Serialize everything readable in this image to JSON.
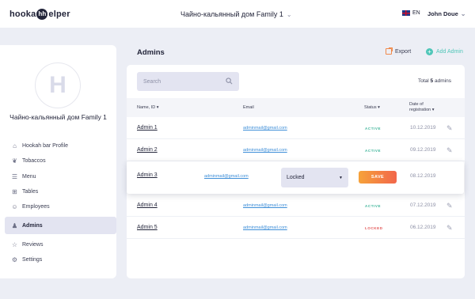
{
  "header": {
    "logo_left": "hooka",
    "logo_mark": "hh",
    "logo_right": "elper",
    "venue": "Чайно-кальянный дом Family 1",
    "language": "EN",
    "user": "John Doue"
  },
  "sidebar": {
    "avatar_letter": "H",
    "venue_name": "Чайно-кальянный дом Family 1",
    "items": [
      {
        "label": "Hookah bar Profile",
        "icon": "home-icon"
      },
      {
        "label": "Tobaccos",
        "icon": "leaf-icon"
      },
      {
        "label": "Menu",
        "icon": "menu-icon"
      },
      {
        "label": "Tables",
        "icon": "table-icon"
      },
      {
        "label": "Employees",
        "icon": "employees-icon"
      },
      {
        "label": "Admins",
        "icon": "admin-icon",
        "active": true
      },
      {
        "label": "Reviews",
        "icon": "star-icon"
      },
      {
        "label": "Settings",
        "icon": "gear-icon"
      }
    ]
  },
  "main": {
    "title": "Admins",
    "export_label": "Export",
    "add_label": "Add Admin",
    "search_placeholder": "Search",
    "total_prefix": "Total",
    "total_count": "5",
    "total_suffix": "admins",
    "columns": {
      "name": "Name, ID",
      "email": "Email",
      "status": "Status",
      "date_line1": "Date of",
      "date_line2": "registration"
    },
    "rows": [
      {
        "name": "Admin 1",
        "email": "adminmail@gmail.com",
        "status": "ACTIVE",
        "date": "10.12.2019"
      },
      {
        "name": "Admin 2",
        "email": "adminmail@gmail.com",
        "status": "ACTIVE",
        "date": "09.12.2019"
      },
      {
        "name": "Admin 3",
        "email": "adminmail@gmail.com",
        "status": "Locked",
        "date": "08.12.2019",
        "save_label": "SAVE"
      },
      {
        "name": "Admin 4",
        "email": "adminmail@gmail.com",
        "status": "ACTIVE",
        "date": "07.12.2019"
      },
      {
        "name": "Admin 5",
        "email": "adminmail@gmail.com",
        "status": "LOCKED",
        "date": "06.12.2019"
      }
    ]
  },
  "colors": {
    "accent_orange": "#f2664a",
    "accent_teal": "#4fc6b8",
    "status_active": "#3fb59a",
    "status_locked": "#e25555",
    "link_blue": "#3f8fd8"
  }
}
